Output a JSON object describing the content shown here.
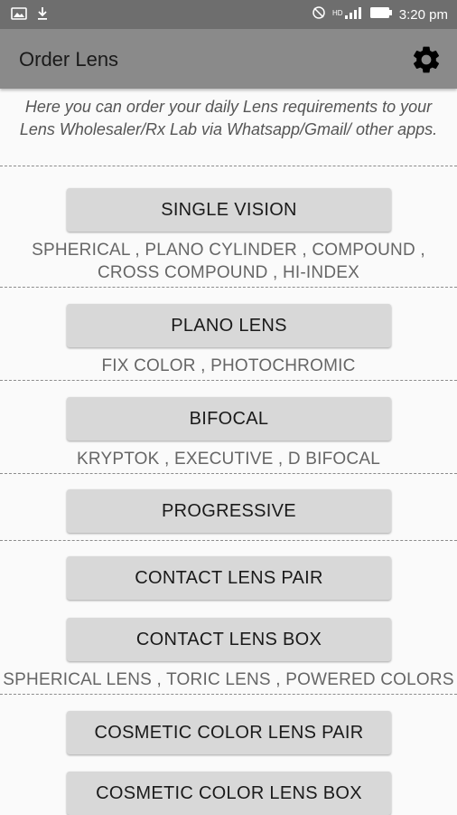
{
  "status_bar": {
    "time": "3:20 pm",
    "icons": [
      "image-icon",
      "download-icon",
      "mute-icon",
      "hd-signal-icon",
      "battery-icon"
    ]
  },
  "toolbar": {
    "title": "Order Lens",
    "settings_icon": "gear-icon"
  },
  "intro_text": "Here you can order your daily Lens requirements to your Lens Wholesaler/Rx Lab via Whatsapp/Gmail/ other apps.",
  "buttons": {
    "single_vision": "SINGLE VISION",
    "plano_lens": "PLANO LENS",
    "bifocal": "BIFOCAL",
    "progressive": "PROGRESSIVE",
    "contact_lens_pair": "CONTACT LENS PAIR",
    "contact_lens_box": "CONTACT LENS BOX",
    "cosmetic_color_lens_pair": "COSMETIC COLOR LENS PAIR",
    "cosmetic_color_lens_box": "COSMETIC COLOR LENS BOX"
  },
  "descriptions": {
    "single_vision_line1": "SPHERICAL , PLANO CYLINDER , COMPOUND ,",
    "single_vision_line2": "CROSS COMPOUND , HI-INDEX",
    "plano_lens": "FIX COLOR , PHOTOCHROMIC",
    "bifocal": "KRYPTOK , EXECUTIVE , D BIFOCAL",
    "contact_lens": "SPHERICAL LENS , TORIC LENS , POWERED COLORS"
  }
}
